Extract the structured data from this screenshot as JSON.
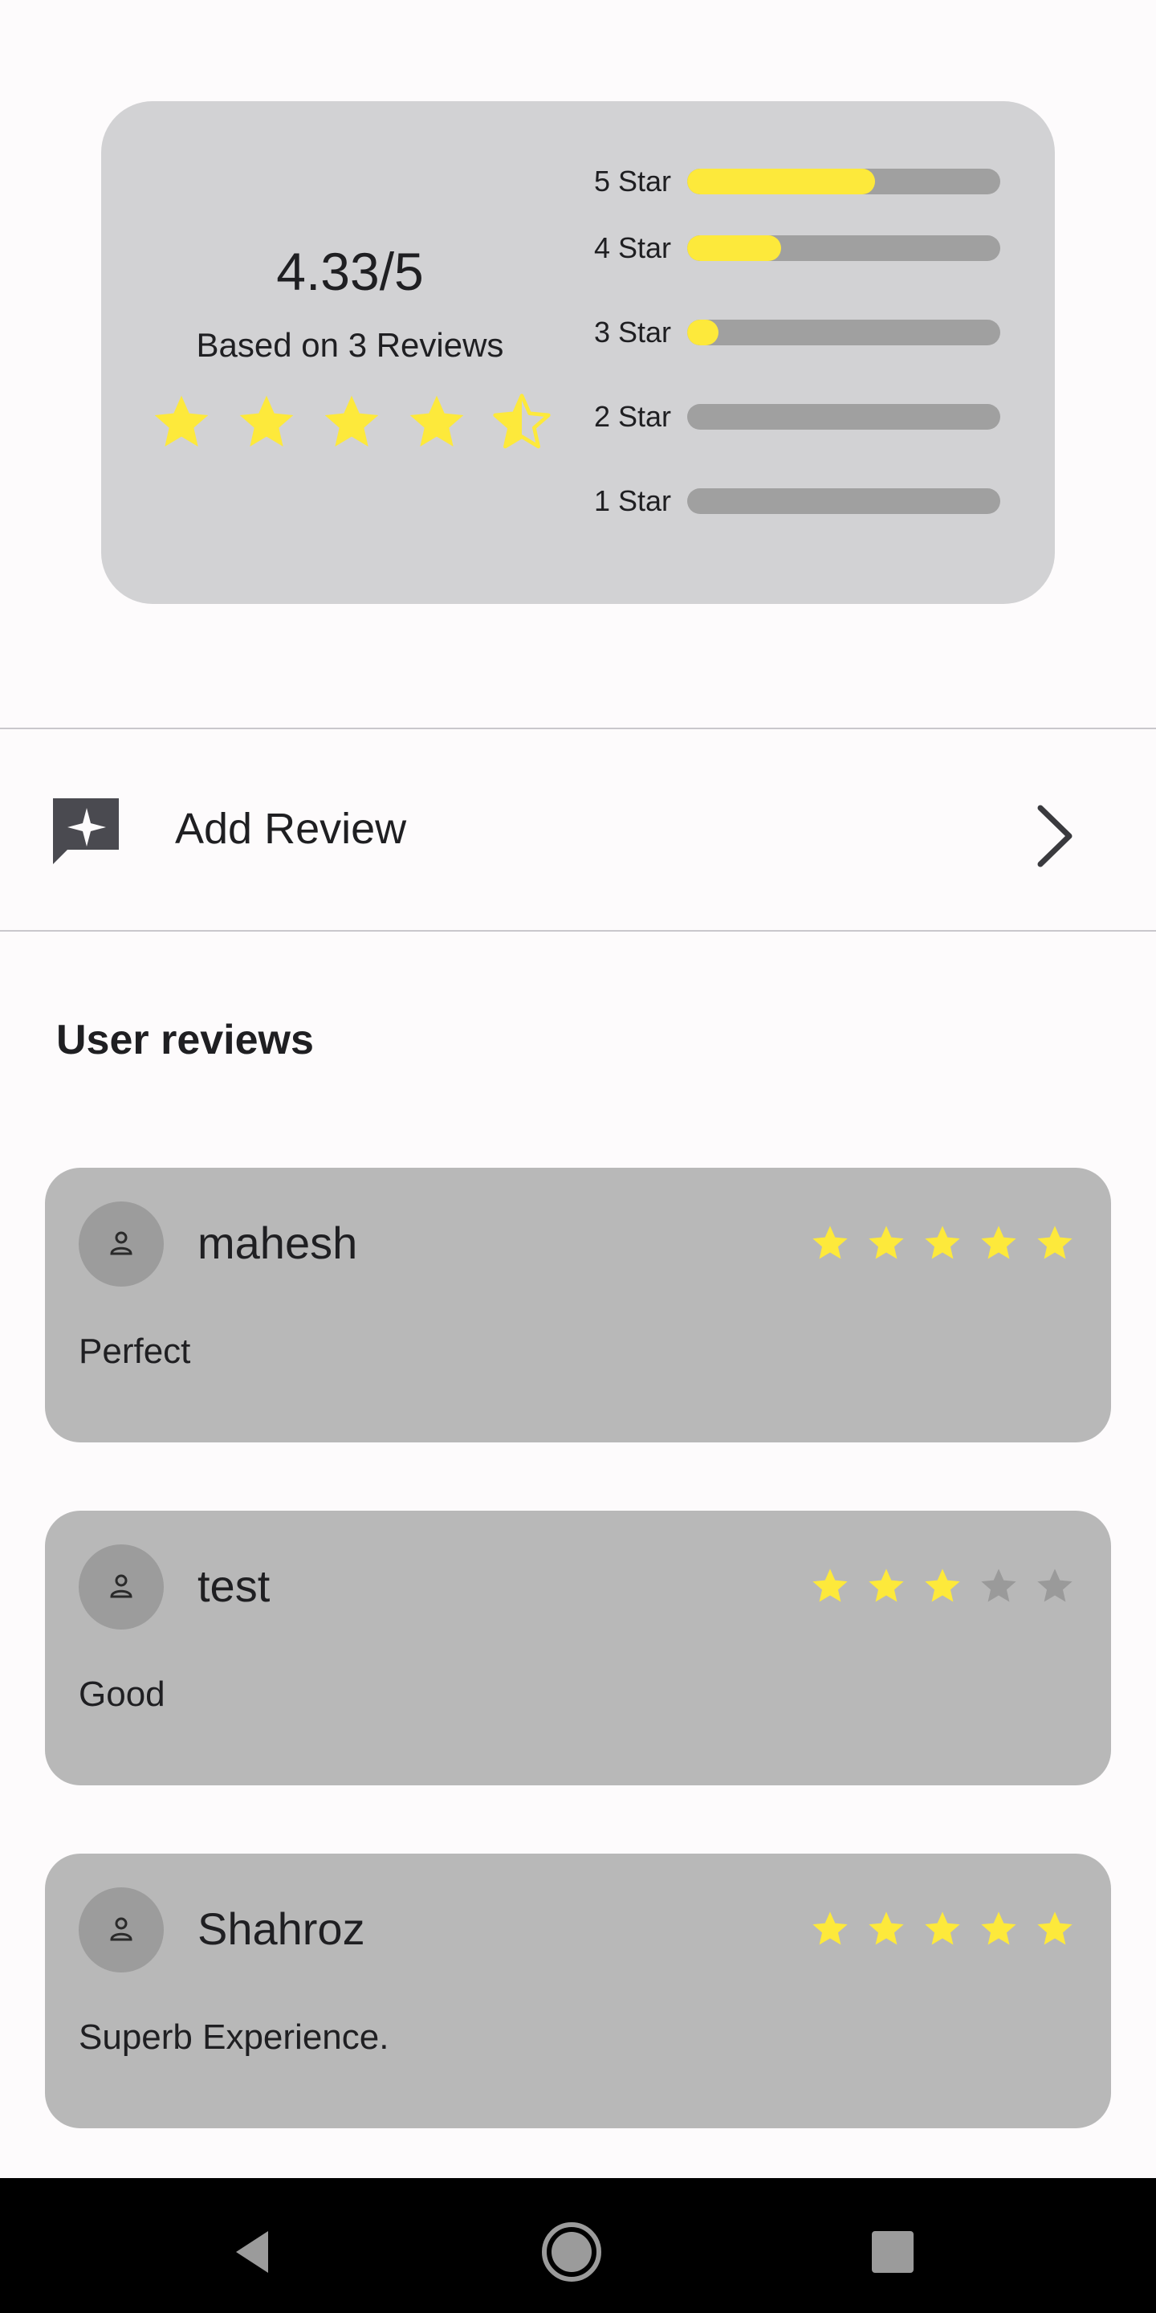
{
  "summary": {
    "average": "4.33/5",
    "based_on": "Based on 3 Reviews",
    "stars": [
      1,
      1,
      1,
      1,
      0.5
    ],
    "distribution": [
      {
        "label": "5 Star",
        "fraction": 0.6
      },
      {
        "label": "4 Star",
        "fraction": 0.3
      },
      {
        "label": "3 Star",
        "fraction": 0.1
      },
      {
        "label": "2 Star",
        "fraction": 0.0
      },
      {
        "label": "1 Star",
        "fraction": 0.0
      }
    ]
  },
  "add_review": {
    "label": "Add Review",
    "icon": "review-sparkle-icon"
  },
  "reviews_section": {
    "title": "User reviews"
  },
  "reviews": [
    {
      "name": "mahesh",
      "rating": 5,
      "text": "Perfect"
    },
    {
      "name": "test",
      "rating": 3,
      "text": "Good"
    },
    {
      "name": "Shahroz",
      "rating": 5,
      "text": "Superb Experience."
    }
  ],
  "colors": {
    "star_filled": "#fde93b",
    "star_empty": "#9a9a9a",
    "card_bg": "#d2d2d4",
    "review_card_bg": "#b8b8b8",
    "bar_track": "#a0a0a0"
  },
  "nav": {
    "back_icon": "back-triangle-icon",
    "home_icon": "home-circle-icon",
    "recents_icon": "recents-square-icon"
  }
}
